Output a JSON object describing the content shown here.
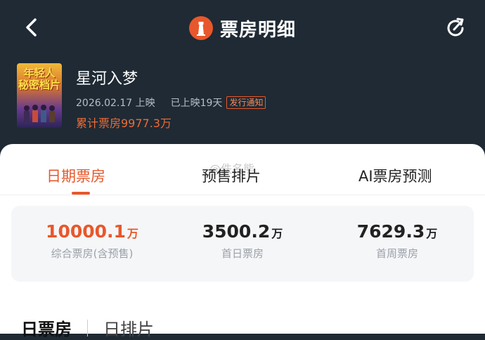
{
  "header": {
    "title": "票房明细",
    "back_icon": "chevron-left-icon",
    "share_icon": "refresh-share-icon",
    "brand_color": "#e8572b"
  },
  "movie": {
    "title": "星河入梦",
    "poster_text": "年轻人 秘密档片",
    "release": "2026.02.17 上映",
    "days": "已上映19天",
    "notice": "发行通知",
    "total": "累计票房9977.3万"
  },
  "tabs": [
    {
      "label": "日期票房",
      "active": true
    },
    {
      "label": "预售排片",
      "active": false
    },
    {
      "label": "AI票房预测",
      "active": false
    }
  ],
  "watermark": "@佚名熊",
  "stats": [
    {
      "value": "10000.1",
      "unit": "万",
      "label": "综合票房(含预售)"
    },
    {
      "value": "3500.2",
      "unit": "万",
      "label": "首日票房"
    },
    {
      "value": "7629.3",
      "unit": "万",
      "label": "首周票房"
    }
  ],
  "bottom_tabs": {
    "active": "日票房",
    "inactive": "日排片"
  }
}
